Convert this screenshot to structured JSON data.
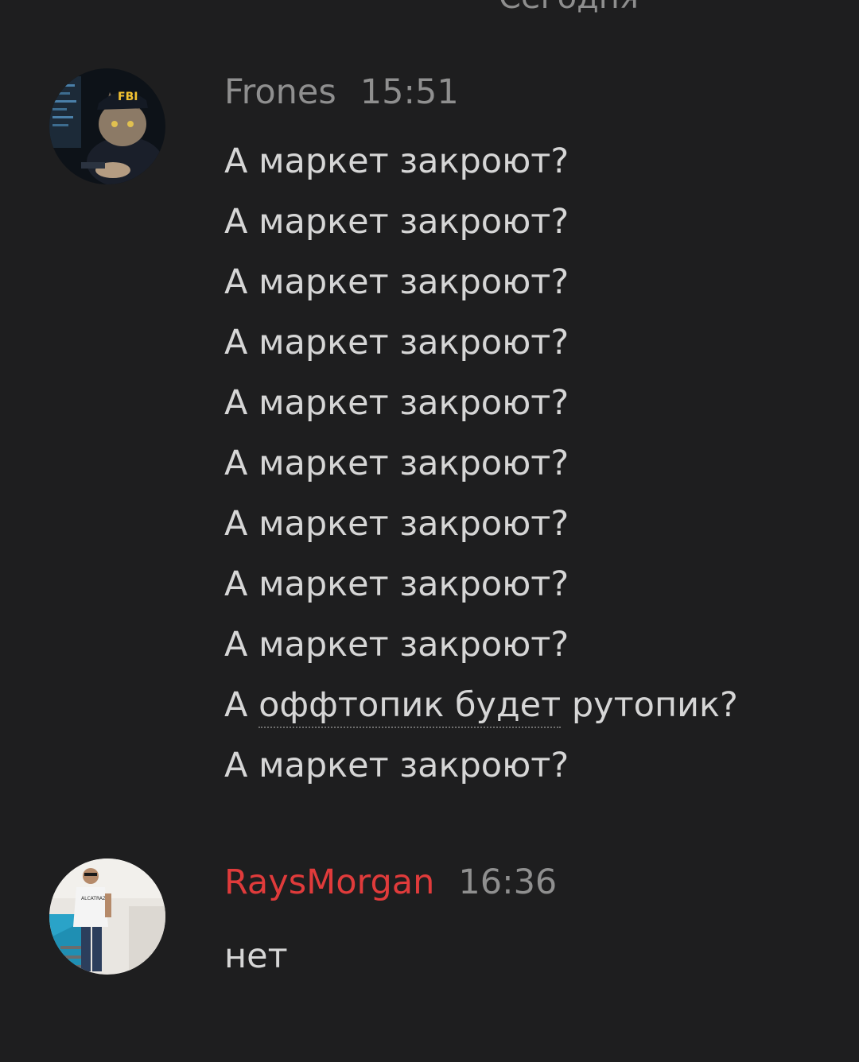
{
  "date_divider": "Сегодня",
  "messages": [
    {
      "username": "Frones",
      "time": "15:51",
      "lines": [
        "А маркет закроют?",
        "А маркет закроют?",
        "А маркет закроют?",
        "А маркет закроют?",
        "А маркет закроют?",
        "А маркет закроют?",
        "А маркет закроют?",
        "А маркет закроют?",
        "А маркет закроют?",
        "А маркет закроют?"
      ],
      "special_line": {
        "prefix": "А ",
        "link": "оффтопик будет",
        "suffix": " рутопик?"
      },
      "username_color": "#8f8f8f",
      "avatar_icon": "cat-fbi-avatar-icon"
    },
    {
      "username": "RaysMorgan",
      "time": "16:36",
      "lines": [
        "нет"
      ],
      "username_color": "#e03b3b",
      "avatar_icon": "man-photo-avatar-icon"
    }
  ]
}
